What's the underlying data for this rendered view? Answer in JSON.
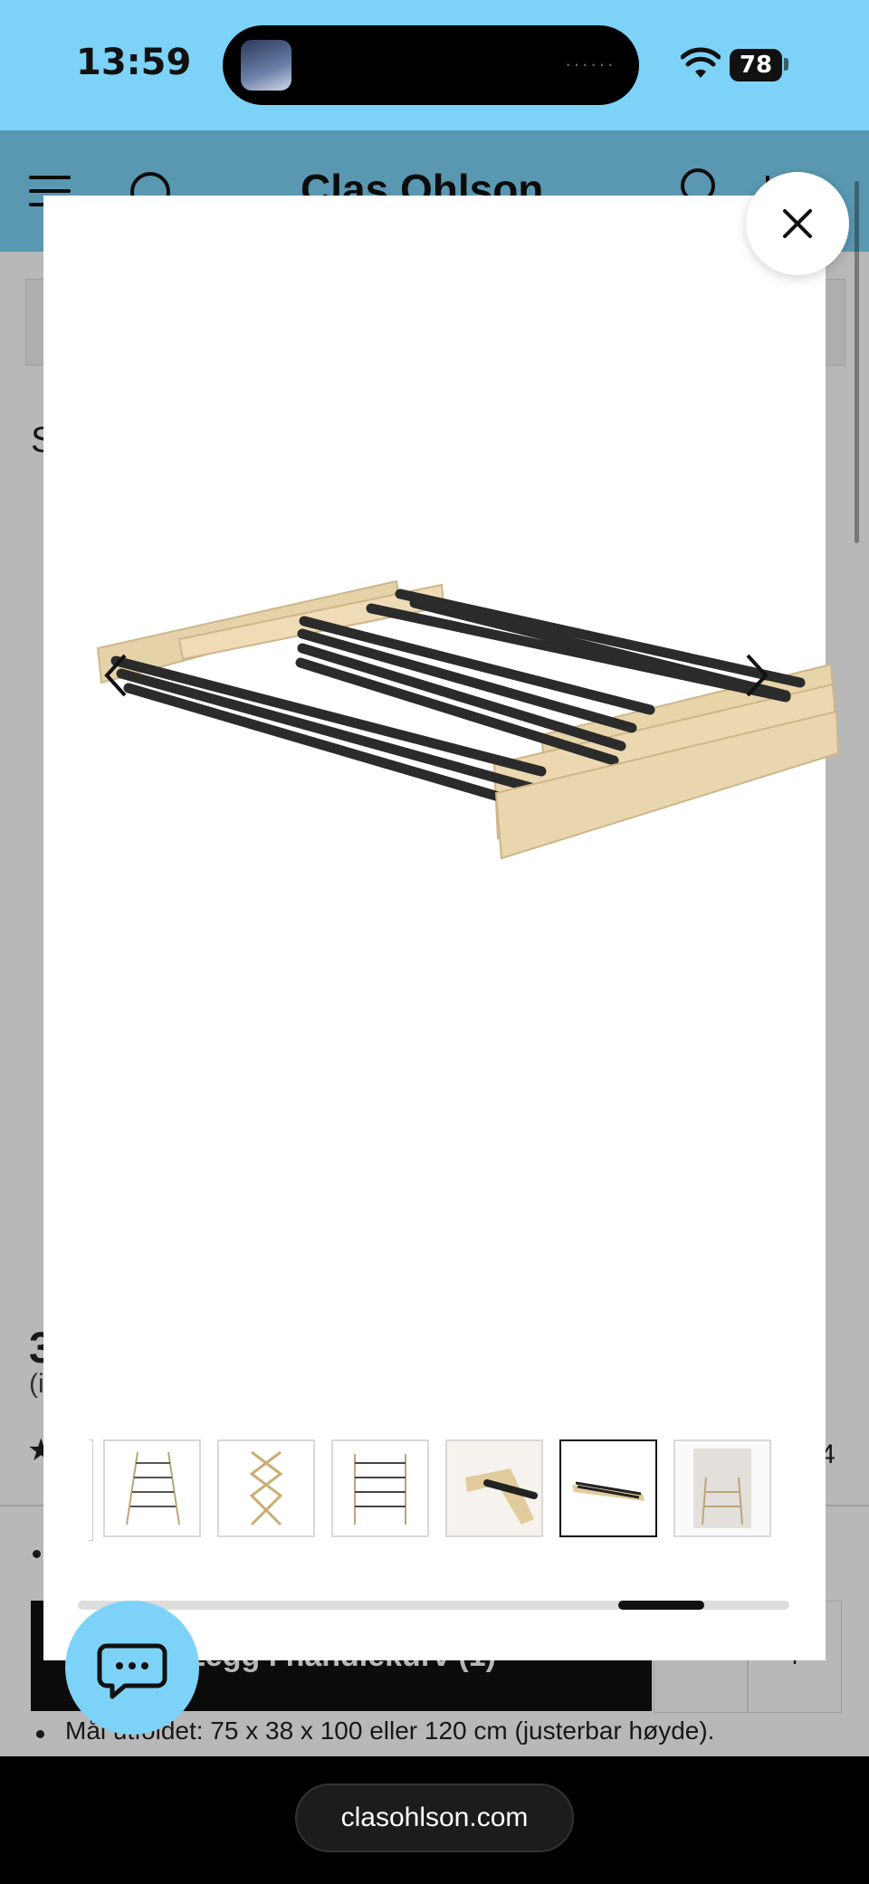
{
  "status_bar": {
    "time": "13:59",
    "battery": "78"
  },
  "site": {
    "brand": "Clas Ohlson",
    "title_fragment": "S",
    "price_fragment": "3",
    "price_sub_fragment": "(i",
    "review_count_fragment": "4",
    "add_to_cart": "Legg i handlekurv (1)",
    "qty_minus": "-",
    "qty_plus": "+",
    "size_line": "Mål utfoldet: 75 x 38 x 100 eller 120 cm (justerbar høyde)."
  },
  "gallery": {
    "current_index": 5,
    "thumbnail_count": 6,
    "scroll_progress": {
      "start": 0.76,
      "end": 0.88
    },
    "thumbnails": [
      {
        "name": "thumb-folding-rack-1"
      },
      {
        "name": "thumb-folding-rack-x"
      },
      {
        "name": "thumb-folding-rack-3"
      },
      {
        "name": "thumb-detail-joint"
      },
      {
        "name": "thumb-folded-flat"
      },
      {
        "name": "thumb-in-room"
      }
    ]
  },
  "browser": {
    "url": "clasohlson.com"
  },
  "colors": {
    "accent": "#7dd3f7",
    "dark": "#111111"
  }
}
